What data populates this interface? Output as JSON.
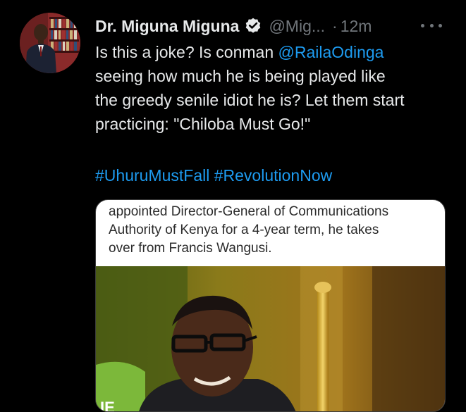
{
  "tweet": {
    "display_name": "Dr. Miguna Miguna",
    "handle": "@Mig...",
    "separator": "·",
    "time": "12m",
    "text_lines": [
      {
        "pre": "Is this a joke? Is conman ",
        "mention": "@RailaOdinga",
        "post": ""
      },
      {
        "pre": "seeing how much he is being played like",
        "mention": "",
        "post": ""
      },
      {
        "pre": "the greedy senile idiot he is? Let them start",
        "mention": "",
        "post": ""
      },
      {
        "pre": "practicing: \"Chiloba Must Go!\"",
        "mention": "",
        "post": ""
      }
    ],
    "hashtags": [
      "#UhuruMustFall",
      "#RevolutionNow"
    ],
    "media_caption_lines": [
      "appointed Director-General of Communications",
      "Authority of Kenya for a 4-year term, he takes",
      "over from Francis Wangusi."
    ]
  },
  "colors": {
    "background": "#000000",
    "text": "#e7e9ea",
    "muted": "#71767b",
    "link": "#1d9bf0"
  },
  "icons": {
    "verified": "verified-badge-icon",
    "more": "more-options-icon"
  }
}
